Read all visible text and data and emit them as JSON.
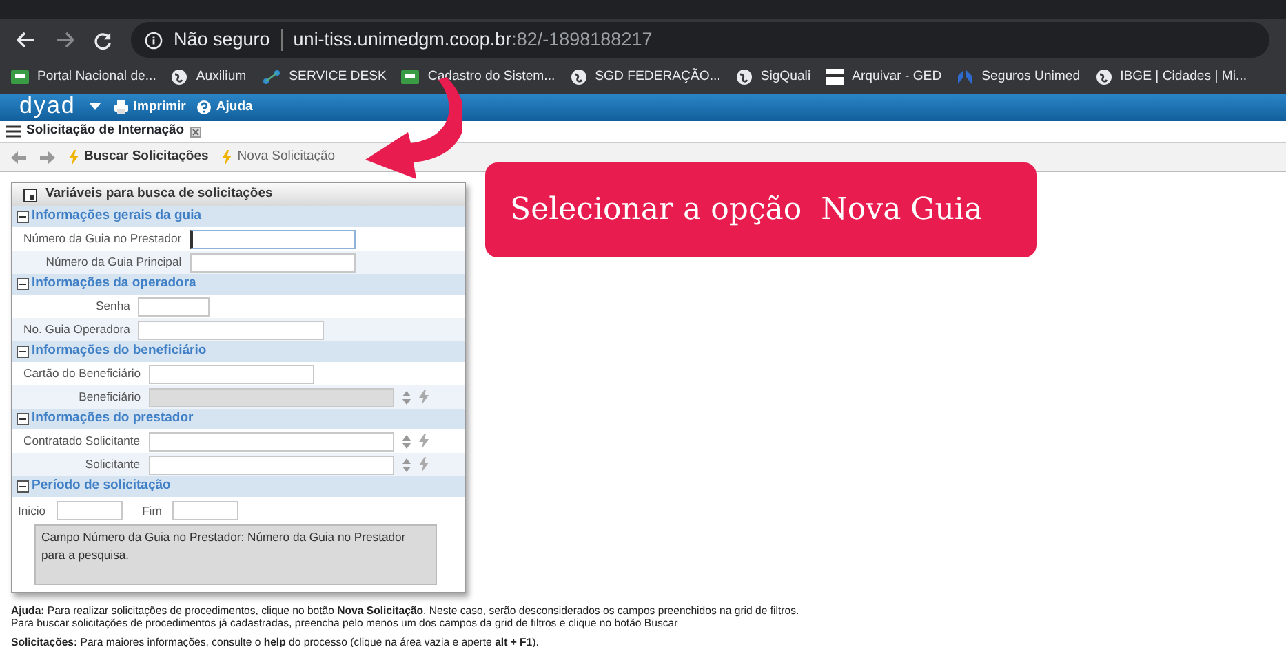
{
  "browser": {
    "security": "Não seguro",
    "host": "uni-tiss.unimedgm.coop.br",
    "path": ":82/-1898188217"
  },
  "bookmarks": [
    {
      "label": "Portal Nacional de...",
      "kind": "site"
    },
    {
      "label": "Auxilium",
      "kind": "globe"
    },
    {
      "label": "SERVICE DESK",
      "kind": "service"
    },
    {
      "label": "Cadastro do Sistem...",
      "kind": "site"
    },
    {
      "label": "SGD FEDERAÇÃO...",
      "kind": "globe"
    },
    {
      "label": "SigQuali",
      "kind": "globe"
    },
    {
      "label": "Arquivar - GED",
      "kind": "doc"
    },
    {
      "label": "Seguros Unimed",
      "kind": "lungs"
    },
    {
      "label": "IBGE | Cidades | Mi...",
      "kind": "globe"
    }
  ],
  "app_bar": {
    "logo": "dyad",
    "menu": [
      {
        "label": "Imprimir",
        "kind": "print"
      },
      {
        "label": "Ajuda",
        "kind": "help"
      }
    ]
  },
  "tab": {
    "label": "Solicitação de Internação"
  },
  "toolbar": [
    {
      "label": "Buscar Solicitações",
      "bold": true
    },
    {
      "label": "Nova Solicitação",
      "bold": false
    }
  ],
  "panel": {
    "title": "Variáveis para busca de solicitações",
    "sections": [
      {
        "title": "Informações gerais da guia",
        "fields": [
          {
            "label": "Número da Guia no Prestador",
            "kind": "text",
            "disabled": false,
            "focused": true
          },
          {
            "label": "Número da Guia Principal",
            "kind": "text",
            "disabled": false,
            "focused": false
          }
        ]
      },
      {
        "title": "Informações da operadora",
        "fields": [
          {
            "label": "Senha",
            "kind": "short",
            "disabled": false,
            "focused": false
          },
          {
            "label": "No. Guia Operadora",
            "kind": "wide",
            "disabled": false,
            "focused": false
          }
        ]
      },
      {
        "title": "Informações do beneficiário",
        "fields": [
          {
            "label": "Cartão do Beneficiário",
            "kind": "text",
            "disabled": false,
            "focused": false
          },
          {
            "label": "Beneficiário",
            "kind": "lookup",
            "disabled": true,
            "focused": false
          }
        ]
      },
      {
        "title": "Informações do prestador",
        "fields": [
          {
            "label": "Contratado Solicitante",
            "kind": "lookup",
            "disabled": false,
            "focused": false
          },
          {
            "label": "Solicitante",
            "kind": "lookup",
            "disabled": false,
            "focused": false
          }
        ]
      }
    ],
    "period": {
      "title": "Período de solicitação",
      "start": "Inicio",
      "end": "Fim"
    },
    "description": "Campo Número da Guia no Prestador: Número da Guia no Prestador para a pesquisa."
  },
  "help": [
    "**Ajuda:** Para realizar solicitações de procedimentos, clique no botão **Nova Solicitação**. Neste caso, serão desconsiderados os campos preenchidos na grid de filtros.",
    "Para buscar solicitações de procedimentos já cadastradas, preencha pelo menos um dos campos da grid de filtros e clique no botão Buscar"
  ],
  "note": "**Solicitações:** Para maiores informações, consulte o **help** do processo (clique na área vazia e aperte **alt + F1**).",
  "callout": "Selecionar a opção  Nova Guia"
}
